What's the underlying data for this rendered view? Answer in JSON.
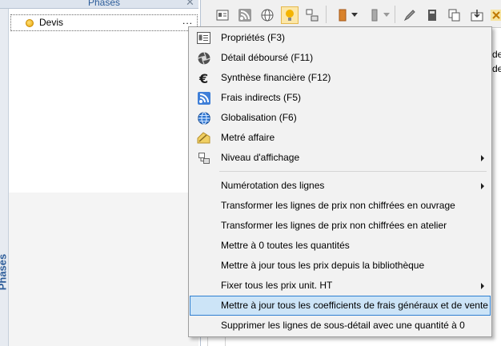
{
  "phases_panel": {
    "title": "Phases",
    "close_glyph": "✕",
    "vertical_tab_label": "Phases",
    "tree": {
      "item_label": "Devis",
      "item_icon": "phase-bullet-icon",
      "ellipsis": "..."
    }
  },
  "toolbar": {
    "buttons": [
      "properties-icon",
      "rss-feed-icon",
      "globe-icon",
      "lightbulb-icon",
      "hierarchy-icon",
      "book-icon",
      "dropdown-arrow-icon",
      "column-icon",
      "dropdown-arrow-icon",
      "pencil-icon",
      "calculator-icon",
      "copy-icon",
      "save-download-icon",
      "close-icon"
    ],
    "active_button": "lightbulb-icon"
  },
  "grid_fragments": [
    "de",
    "de"
  ],
  "context_menu": {
    "items": [
      {
        "label": "Propriétés (F3)",
        "icon": "properties-card-icon"
      },
      {
        "label": "Détail déboursé (F11)",
        "icon": "aperture-icon"
      },
      {
        "label": "Synthèse financière (F12)",
        "icon": "euro-icon"
      },
      {
        "label": "Frais indirects (F5)",
        "icon": "rss-feed-icon"
      },
      {
        "label": "Globalisation (F6)",
        "icon": "globe-icon"
      },
      {
        "label": "Metré affaire",
        "icon": "ruler-pencil-icon"
      },
      {
        "label": "Niveau d'affichage",
        "icon": "hierarchy-icon",
        "submenu": true
      },
      {
        "label": "Numérotation des lignes",
        "submenu": true
      },
      {
        "label": "Transformer les lignes de prix non chiffrées en ouvrage"
      },
      {
        "label": "Transformer les lignes de prix non chiffrées en atelier"
      },
      {
        "label": "Mettre à 0 toutes les quantités"
      },
      {
        "label": "Mettre à jour tous les prix depuis la bibliothèque"
      },
      {
        "label": "Fixer tous les prix unit. HT",
        "submenu": true
      },
      {
        "label": "Mettre à jour tous les coefficients de frais généraux et de vente",
        "highlighted": true
      },
      {
        "label": "Supprimer les lignes de sous-détail avec une quantité à 0"
      }
    ]
  }
}
